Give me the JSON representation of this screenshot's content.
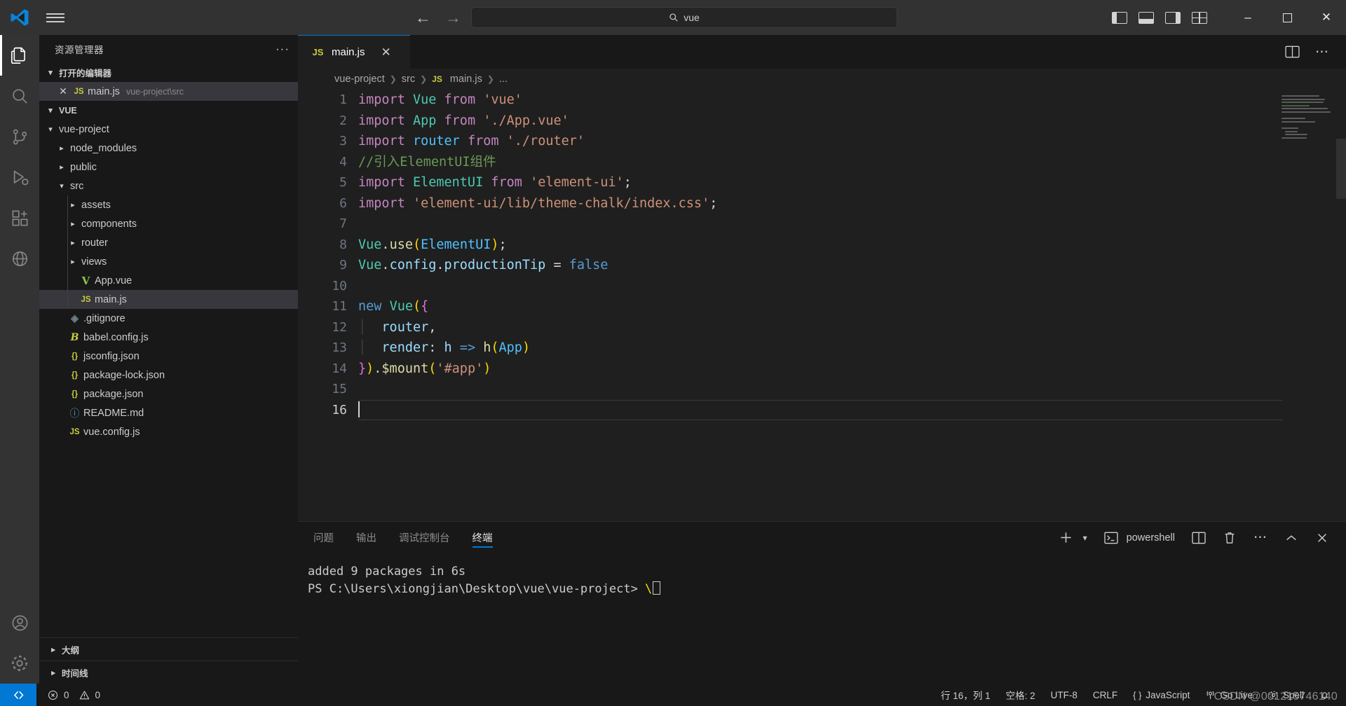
{
  "titlebar": {
    "logo_icon": "vscode-logo-icon",
    "menu_icon": "hamburger-menu-icon",
    "back_icon": "arrow-left-icon",
    "forward_icon": "arrow-right-icon",
    "search_icon": "search-icon",
    "search_value": "vue",
    "layout_icons": [
      "toggle-primary-sidebar-icon",
      "toggle-panel-icon",
      "toggle-secondary-sidebar-icon",
      "customize-layout-icon"
    ],
    "minimize_label": "–",
    "maximize_label": "❐",
    "close_label": "✕"
  },
  "activitybar": {
    "items": [
      {
        "name": "explorer",
        "icon": "files-icon",
        "active": true
      },
      {
        "name": "search",
        "icon": "search-icon",
        "active": false
      },
      {
        "name": "source-control",
        "icon": "source-control-icon",
        "active": false
      },
      {
        "name": "run-and-debug",
        "icon": "run-debug-icon",
        "active": false
      },
      {
        "name": "extensions",
        "icon": "extensions-icon",
        "active": false
      },
      {
        "name": "remote-explorer",
        "icon": "remote-explorer-icon",
        "active": false
      }
    ],
    "bottom": [
      {
        "name": "accounts",
        "icon": "account-icon"
      },
      {
        "name": "settings",
        "icon": "gear-icon"
      }
    ]
  },
  "sidebar": {
    "title": "资源管理器",
    "more_actions": "···",
    "open_editors": {
      "label": "打开的编辑器",
      "items": [
        {
          "close": "✕",
          "icon": "js-file-icon",
          "icon_text": "JS",
          "name": "main.js",
          "desc": "vue-project\\src",
          "selected": true
        }
      ]
    },
    "workspace": {
      "label": "VUE",
      "tree": [
        {
          "indent": 1,
          "arrow": "chevron-down",
          "icon": "folder-icon",
          "icon_text": "",
          "name": "vue-project",
          "selected": false
        },
        {
          "indent": 2,
          "arrow": "chevron-right",
          "icon": "folder-icon",
          "icon_text": "",
          "name": "node_modules",
          "selected": false
        },
        {
          "indent": 2,
          "arrow": "chevron-right",
          "icon": "folder-icon",
          "icon_text": "",
          "name": "public",
          "selected": false
        },
        {
          "indent": 2,
          "arrow": "chevron-down",
          "icon": "folder-icon",
          "icon_text": "",
          "name": "src",
          "selected": false
        },
        {
          "indent": 3,
          "arrow": "chevron-right",
          "icon": "folder-icon",
          "icon_text": "",
          "name": "assets",
          "selected": false
        },
        {
          "indent": 3,
          "arrow": "chevron-right",
          "icon": "folder-icon",
          "icon_text": "",
          "name": "components",
          "selected": false
        },
        {
          "indent": 3,
          "arrow": "chevron-right",
          "icon": "folder-icon",
          "icon_text": "",
          "name": "router",
          "selected": false
        },
        {
          "indent": 3,
          "arrow": "chevron-right",
          "icon": "folder-icon",
          "icon_text": "",
          "name": "views",
          "selected": false
        },
        {
          "indent": 3,
          "arrow": "none",
          "icon": "vue-file-icon",
          "icon_text": "V",
          "name": "App.vue",
          "selected": false
        },
        {
          "indent": 3,
          "arrow": "none",
          "icon": "js-file-icon",
          "icon_text": "JS",
          "name": "main.js",
          "selected": true
        },
        {
          "indent": 2,
          "arrow": "none",
          "icon": "git-file-icon",
          "icon_text": "◈",
          "name": ".gitignore",
          "selected": false
        },
        {
          "indent": 2,
          "arrow": "none",
          "icon": "babel-file-icon",
          "icon_text": "B",
          "name": "babel.config.js",
          "selected": false
        },
        {
          "indent": 2,
          "arrow": "none",
          "icon": "json-file-icon",
          "icon_text": "{}",
          "name": "jsconfig.json",
          "selected": false
        },
        {
          "indent": 2,
          "arrow": "none",
          "icon": "json-file-icon",
          "icon_text": "{}",
          "name": "package-lock.json",
          "selected": false
        },
        {
          "indent": 2,
          "arrow": "none",
          "icon": "json-file-icon",
          "icon_text": "{}",
          "name": "package.json",
          "selected": false
        },
        {
          "indent": 2,
          "arrow": "none",
          "icon": "markdown-file-icon",
          "icon_text": "ⓘ",
          "name": "README.md",
          "selected": false
        },
        {
          "indent": 2,
          "arrow": "none",
          "icon": "js-file-icon",
          "icon_text": "JS",
          "name": "vue.config.js",
          "selected": false
        }
      ]
    },
    "bottom_sections": [
      {
        "label": "大纲"
      },
      {
        "label": "时间线"
      }
    ]
  },
  "editor": {
    "tab": {
      "icon": "js-file-icon",
      "icon_text": "JS",
      "label": "main.js",
      "close": "✕"
    },
    "tab_actions": [
      "split-editor-icon",
      "more-actions-icon"
    ],
    "breadcrumb": [
      "vue-project",
      "src",
      "main.js",
      "..."
    ],
    "breadcrumb_file_icon": "JS",
    "lines": [
      {
        "n": "1",
        "active": false
      },
      {
        "n": "2",
        "active": false
      },
      {
        "n": "3",
        "active": false
      },
      {
        "n": "4",
        "active": false
      },
      {
        "n": "5",
        "active": false
      },
      {
        "n": "6",
        "active": false
      },
      {
        "n": "7",
        "active": false
      },
      {
        "n": "8",
        "active": false
      },
      {
        "n": "9",
        "active": false
      },
      {
        "n": "10",
        "active": false
      },
      {
        "n": "11",
        "active": false
      },
      {
        "n": "12",
        "active": false
      },
      {
        "n": "13",
        "active": false
      },
      {
        "n": "14",
        "active": false
      },
      {
        "n": "15",
        "active": false
      },
      {
        "n": "16",
        "active": true
      }
    ],
    "source_text": [
      "import Vue from 'vue'",
      "import App from './App.vue'",
      "import router from './router'",
      "//引入ElementUI组件",
      "import ElementUI from 'element-ui';",
      "import 'element-ui/lib/theme-chalk/index.css';",
      "",
      "Vue.use(ElementUI);",
      "Vue.config.productionTip = false",
      "",
      "new Vue({",
      "  router,",
      "  render: h => h(App)",
      "}).$mount('#app')",
      "",
      ""
    ]
  },
  "panel": {
    "tabs": [
      {
        "label": "问题",
        "active": false
      },
      {
        "label": "输出",
        "active": false
      },
      {
        "label": "调试控制台",
        "active": false
      },
      {
        "label": "终端",
        "active": true
      }
    ],
    "actions": {
      "new_terminal_icon": "plus-icon",
      "new_terminal_dropdown_icon": "chevron-down-icon",
      "shell_icon": "terminal-icon",
      "shell_label": "powershell",
      "split_icon": "split-terminal-icon",
      "kill_icon": "trash-icon",
      "more_icon": "more-actions-icon",
      "maximize_icon": "chevron-up-icon",
      "close_icon": "close-icon"
    },
    "terminal_lines": [
      "added 9 packages in 6s",
      "PS C:\\Users\\xiongjian\\Desktop\\vue\\vue-project> "
    ]
  },
  "statusbar": {
    "remote_icon": "remote-window-icon",
    "errors_icon": "error-icon",
    "errors": "0",
    "warnings_icon": "warning-icon",
    "warnings": "0",
    "right_items": [
      {
        "name": "cursor-position",
        "label": "行 16，列 1"
      },
      {
        "name": "indentation",
        "label": "空格: 2"
      },
      {
        "name": "encoding",
        "label": "UTF-8"
      },
      {
        "name": "eol",
        "label": "CRLF"
      },
      {
        "name": "language-mode",
        "label": "JavaScript",
        "icon": "js-braces-icon"
      },
      {
        "name": "go-live",
        "label": "Go Live",
        "icon": "broadcast-icon"
      },
      {
        "name": "spell-checker",
        "label": "Spell",
        "icon": "gear-icon"
      },
      {
        "name": "notifications",
        "label": "",
        "icon": "bell-icon"
      }
    ]
  },
  "watermark": "CSDN @001215746140",
  "colors": {
    "accent": "#0078d4",
    "titlebar_bg": "#323233",
    "sidebar_bg": "#181818",
    "editor_bg": "#1f1f1f",
    "selection_bg": "#37373d",
    "active_tab_border": "#0078d4",
    "keyword": "#C586C0",
    "control": "#569CD6",
    "string": "#CE9178",
    "comment": "#6A9955",
    "function": "#DCDCAA",
    "class": "#4EC9B0",
    "property": "#9CDCFE",
    "variable": "#4FC1FF",
    "bracket1": "#FFD700",
    "bracket2": "#DA70D6"
  }
}
